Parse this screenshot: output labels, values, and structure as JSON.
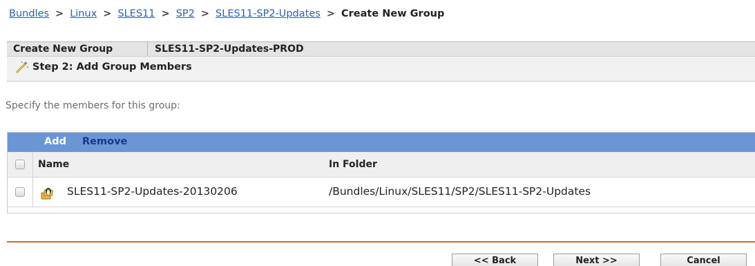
{
  "breadcrumb": {
    "items": [
      "Bundles",
      "Linux",
      "SLES11",
      "SP2",
      "SLES11-SP2-Updates"
    ],
    "current": "Create New Group",
    "separator": ">"
  },
  "title_bar": {
    "label": "Create New Group",
    "group_name": "SLES11-SP2-Updates-PROD"
  },
  "step": {
    "label": "Step 2: Add Group Members",
    "icon": "wizard-wand-icon"
  },
  "instruction": "Specify the members for this group:",
  "table": {
    "toolbar": {
      "add": "Add",
      "remove": "Remove"
    },
    "columns": [
      "Name",
      "In Folder"
    ],
    "rows": [
      {
        "name": "SLES11-SP2-Updates-20130206",
        "folder": "/Bundles/Linux/SLES11/SP2/SLES11-SP2-Updates",
        "icon": "linux-bundle-icon"
      }
    ]
  },
  "buttons": {
    "back": "<< Back",
    "next": "Next >>",
    "cancel": "Cancel"
  },
  "colors": {
    "link": "#2f5fa8",
    "toolbar": "#6b96d4",
    "toolbar_remove": "#14398c",
    "divider": "#d3662a"
  }
}
